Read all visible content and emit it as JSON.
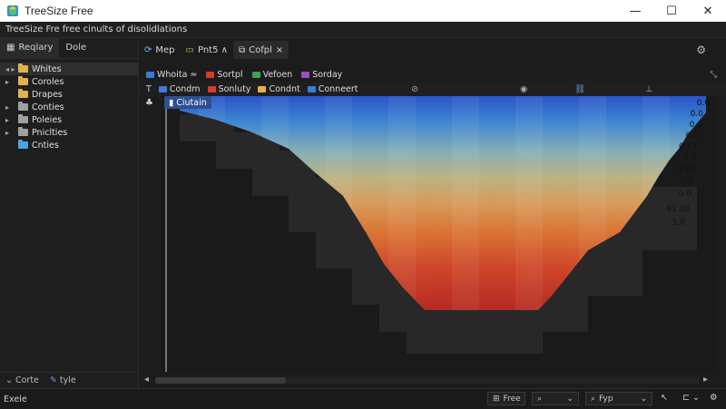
{
  "window": {
    "title": "TreeSize Free",
    "subtitle": "TreeSize Fre  free cinults of disolidlations"
  },
  "left_panel": {
    "tabs": [
      "Reqlary",
      "Dole"
    ],
    "tree": [
      {
        "label": "Whites",
        "color": "#e0b34a",
        "arrow": "▸"
      },
      {
        "label": "Coroles",
        "color": "#e0b34a",
        "arrow": "▸"
      },
      {
        "label": "Drapes",
        "color": "#e0b34a",
        "arrow": ""
      },
      {
        "label": "Conties",
        "color": "#a0a0a0",
        "arrow": "▸"
      },
      {
        "label": "Poleies",
        "color": "#a0a0a0",
        "arrow": "▸"
      },
      {
        "label": "Pniclties",
        "color": "#a0a0a0",
        "arrow": "▸"
      },
      {
        "label": "Cnties",
        "color": "#4aa3df",
        "arrow": ""
      }
    ],
    "bottom": {
      "left": "Corte",
      "right": "tyle"
    }
  },
  "main": {
    "tabs": [
      {
        "label": "Mep",
        "icon": "refresh-icon"
      },
      {
        "label": "Pnt5 ∧",
        "icon": "folder-icon"
      },
      {
        "label": "Cofpl",
        "icon": "copy-icon",
        "close": "×"
      }
    ],
    "legend_row1": [
      {
        "label": "Whoita ≈",
        "color": "#3d7bd6"
      },
      {
        "label": "Sortpl",
        "color": "#d33b2f"
      },
      {
        "label": "Vefoen",
        "color": "#3fa34d"
      },
      {
        "label": "Sorday",
        "color": "#9b4fc2"
      }
    ],
    "legend_row2": [
      {
        "label": "Condm",
        "color": "#3d7bd6"
      },
      {
        "label": "Sonluty",
        "color": "#d33b2f"
      },
      {
        "label": "Condnt",
        "color": "#e0b34a"
      },
      {
        "label": "Conneert",
        "color": "#3d7bd6"
      }
    ],
    "current_tag": "Ciutain",
    "value_labels": [
      "0.0",
      "0.0",
      "0.0",
      "0.0",
      "0.13",
      "0.0",
      "0.30",
      "0.0",
      "0.0",
      "91.00",
      "5.0"
    ],
    "scroll_fraction": 0.24
  },
  "statusbar": {
    "left": "Exele",
    "free_btn": "Free",
    "search_btn": "",
    "type_btn": "Fyp"
  }
}
